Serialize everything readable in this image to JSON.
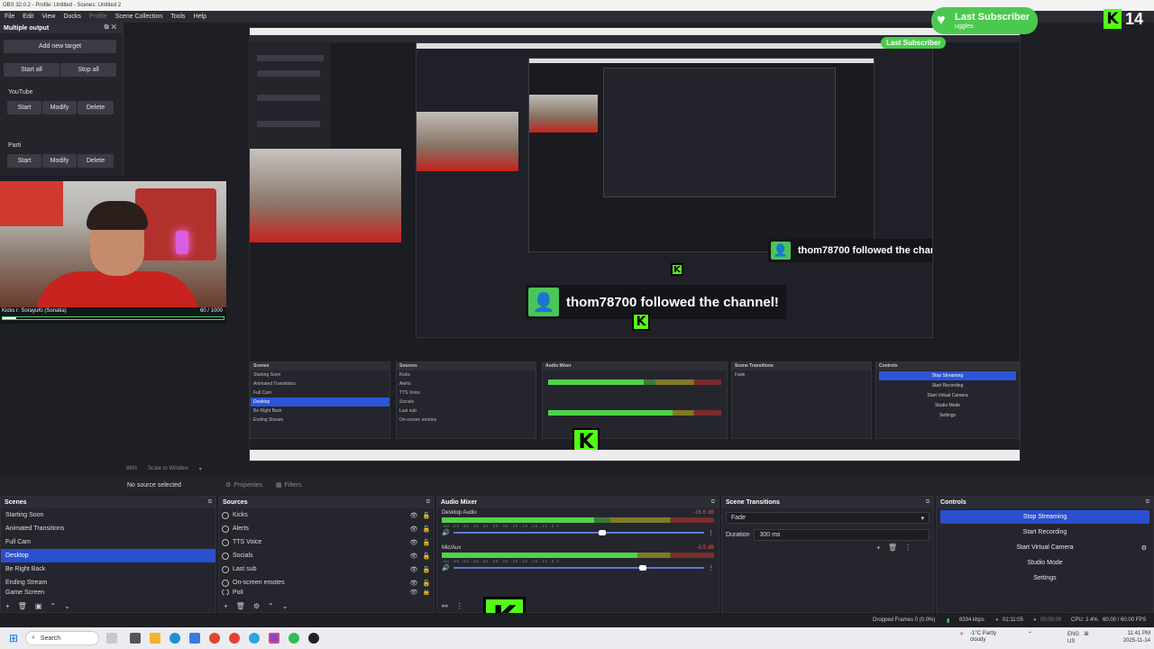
{
  "window": {
    "title": "OBS 32.0.2 - Profile: Untitled - Scenes: Untitled 2"
  },
  "menu": [
    "File",
    "Edit",
    "View",
    "Docks",
    "Profile",
    "Scene Collection",
    "Tools",
    "Help"
  ],
  "multiple_output": {
    "title": "Multiple output",
    "add_target": "Add new target",
    "start_all": "Start all",
    "stop_all": "Stop all",
    "targets": [
      {
        "name": "YouTube",
        "start": "Start",
        "modify": "Modify",
        "delete": "Delete"
      },
      {
        "name": "Parti",
        "start": "Start",
        "modify": "Modify",
        "delete": "Delete"
      }
    ]
  },
  "webcam": {
    "caption": "Kicks r: SorayuKi (Sonatia)",
    "counter": "60 / 1000",
    "progress": 0.06
  },
  "overlay": {
    "last_subscriber_label": "Last Subscriber",
    "last_subscriber_name": "uggles",
    "kick_count": "14",
    "follow_message": "thom78700 followed the channel!"
  },
  "preview_bar": {
    "zoom": "88%",
    "scale": "Scale to Window"
  },
  "source_bar": {
    "no_source": "No source selected",
    "properties": "Properties",
    "filters": "Filters"
  },
  "scenes": {
    "title": "Scenes",
    "items": [
      "Starting Soon",
      "Animated Transitions",
      "Full Cam",
      "Desktop",
      "Be Right Back",
      "Ending Stream",
      "Game Screen"
    ],
    "selected_index": 3
  },
  "sources": {
    "title": "Sources",
    "items": [
      "Kicks",
      "Alerts",
      "TTS Voice",
      "Socials",
      "Last sub",
      "On-screen emotes",
      "Poll"
    ]
  },
  "audio_mixer": {
    "title": "Audio Mixer",
    "channels": [
      {
        "name": "Desktop Audio",
        "db": "-16.6 dB",
        "level": 0.56,
        "volume": 0.58,
        "ticks": "-60 -55 -50 -45 -40 -35 -30 -25 -20 -15 -10 -5 0"
      },
      {
        "name": "Mic/Aux",
        "db": "-8.5 dB",
        "level": 0.72,
        "volume": 0.74,
        "ticks": "-60 -55 -50 -45 -40 -35 -30 -25 -20 -15 -10 -5 0"
      }
    ]
  },
  "transitions": {
    "title": "Scene Transitions",
    "current": "Fade",
    "duration_label": "Duration",
    "duration_value": "300 ms"
  },
  "controls": {
    "title": "Controls",
    "buttons": [
      "Stop Streaming",
      "Start Recording",
      "Start Virtual Camera",
      "Studio Mode",
      "Settings"
    ]
  },
  "status": {
    "dropped": "Dropped Frames 0 (0.0%)",
    "bitrate": "8334 kbps",
    "stream_time": "01:11:05",
    "rec_time": "00:00:00",
    "cpu": "CPU: 2.4%",
    "fps": "60.00 / 60.00 FPS"
  },
  "taskbar": {
    "search_placeholder": "Search",
    "weather": "-1°C Partly cloudy",
    "lang1": "ENG",
    "lang2": "US",
    "time": "11:41 PM",
    "date": "2025-11-14"
  },
  "colors": {
    "kick_green": "#53fc18",
    "accent_blue": "#2a4fcf",
    "follow_green": "#4ac558"
  }
}
